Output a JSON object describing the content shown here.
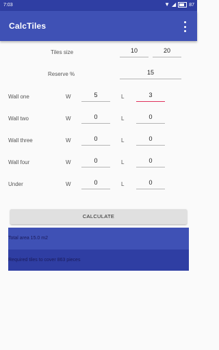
{
  "status_bar": {
    "time": "7:03",
    "battery": "87"
  },
  "app_bar": {
    "title": "CalcTiles"
  },
  "tiles_size": {
    "label": "Tiles size",
    "width": "10",
    "length": "20"
  },
  "reserve": {
    "label": "Reserve %",
    "value": "15"
  },
  "walls": [
    {
      "label": "Wall one",
      "w_label": "W",
      "w": "5",
      "l_label": "L",
      "l": "3"
    },
    {
      "label": "Wall two",
      "w_label": "W",
      "w": "0",
      "l_label": "L",
      "l": "0"
    },
    {
      "label": "Wall three",
      "w_label": "W",
      "w": "0",
      "l_label": "L",
      "l": "0"
    },
    {
      "label": "Wall four",
      "w_label": "W",
      "w": "0",
      "l_label": "L",
      "l": "0"
    },
    {
      "label": "Under",
      "w_label": "W",
      "w": "0",
      "l_label": "L",
      "l": "0"
    }
  ],
  "calculate_button": {
    "label": "CALCULATE"
  },
  "results": {
    "total_area": "Total area 15.0 m2",
    "required_tiles": "Required tiles to cover 863 pieces"
  },
  "colors": {
    "primary": "#3f51b5",
    "primary_dark": "#2f3ea3",
    "accent": "#e0305a"
  }
}
